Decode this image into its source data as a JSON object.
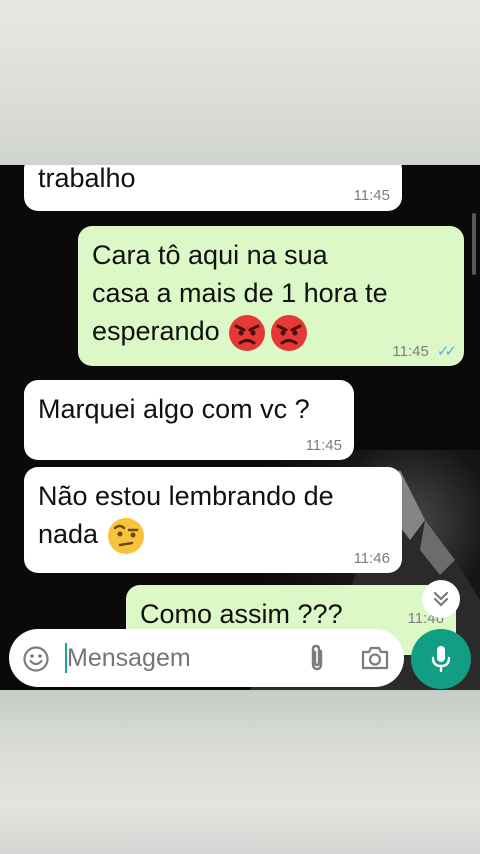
{
  "messages": [
    {
      "text": "trabalho",
      "time": "11:45"
    },
    {
      "text_l1": "Cara tô aqui na sua",
      "text_l2": "casa a mais de 1 hora te",
      "text_l3": "esperando",
      "time": "11:45",
      "emoji": "angry-face"
    },
    {
      "text": "Marquei algo com vc ?",
      "time": "11:45"
    },
    {
      "text_l1": "Não estou lembrando de",
      "text_l2": "nada",
      "time": "11:46",
      "emoji": "face-with-raised-eyebrow"
    },
    {
      "text": "Como assim ???",
      "time": "11:46"
    }
  ],
  "composer": {
    "placeholder": "Mensagem"
  },
  "colors": {
    "incoming": "#ffffff",
    "outgoing": "#dcf8c6",
    "accent": "#129e82",
    "read_ticks": "#4fb3e8"
  },
  "icons": [
    "emoji-icon",
    "attach-icon",
    "camera-icon",
    "microphone-icon",
    "scroll-down-icon",
    "read-ticks-icon"
  ]
}
